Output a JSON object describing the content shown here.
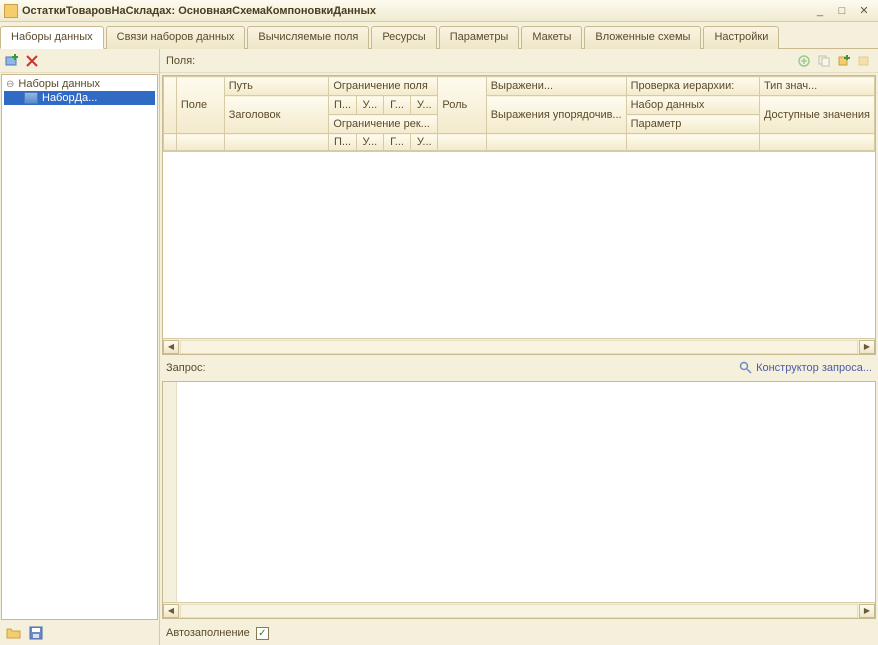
{
  "window": {
    "title": "ОстаткиТоваровНаСкладах: ОсновнаяСхемаКомпоновкиДанных"
  },
  "tabs": [
    "Наборы данных",
    "Связи наборов данных",
    "Вычисляемые поля",
    "Ресурсы",
    "Параметры",
    "Макеты",
    "Вложенные схемы",
    "Настройки"
  ],
  "tree": {
    "root": "Наборы данных",
    "child": "НаборДа..."
  },
  "fields": {
    "label": "Поля:",
    "headers": {
      "field": "Поле",
      "path": "Путь",
      "restriction_field": "Ограничение поля",
      "role": "Роль",
      "expression": "Выражени...",
      "hierarchy_check": "Проверка иерархии:",
      "value_type": "Тип знач...",
      "header": "Заголовок",
      "restriction_rec": "Ограничение рек...",
      "ordering_expr": "Выражения упорядочив...",
      "dataset": "Набор данных",
      "parameter": "Параметр",
      "available_values": "Доступные значения",
      "p": "П...",
      "u": "У...",
      "g": "Г..."
    }
  },
  "query": {
    "label": "Запрос:",
    "designer": "Конструктор запроса..."
  },
  "autofill": {
    "label": "Автозаполнение"
  },
  "icons": {
    "minimize": "_",
    "maximize": "□",
    "close": "✕"
  }
}
